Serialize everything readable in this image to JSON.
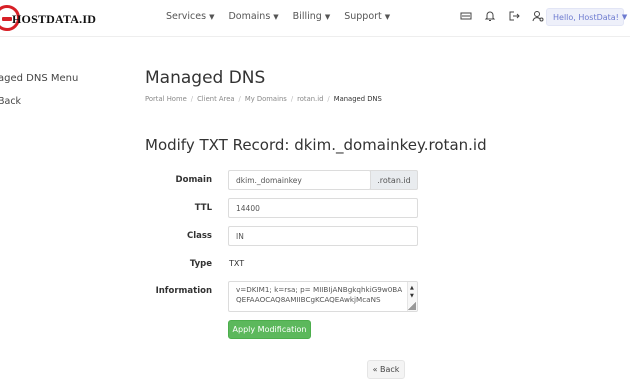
{
  "brand": {
    "name": "HOSTDATA.ID"
  },
  "nav": {
    "items": [
      {
        "label": "Services"
      },
      {
        "label": "Domains"
      },
      {
        "label": "Billing"
      },
      {
        "label": "Support"
      }
    ]
  },
  "header": {
    "icons": [
      "cart-icon",
      "bell-icon",
      "logout-icon",
      "user-settings-icon"
    ],
    "user_menu": "Hello, HostData!"
  },
  "sidebar": {
    "title": "aged DNS Menu",
    "back": "Back"
  },
  "page": {
    "title": "Managed DNS",
    "breadcrumb": [
      {
        "label": "Portal Home"
      },
      {
        "label": "Client Area"
      },
      {
        "label": "My Domains"
      },
      {
        "label": "rotan.id"
      },
      {
        "label": "Managed DNS"
      }
    ],
    "breadcrumb_sep": "/"
  },
  "form": {
    "title": "Modify TXT Record: dkim._domainkey.rotan.id",
    "domain_label": "Domain",
    "domain_value": "dkim._domainkey",
    "domain_suffix": ".rotan.id",
    "ttl_label": "TTL",
    "ttl_value": "14400",
    "class_label": "Class",
    "class_value": "IN",
    "type_label": "Type",
    "type_value": "TXT",
    "info_label": "Information",
    "info_value": "v=DKIM1; k=rsa; p= MIIBIjANBgkqhkiG9w0BAQEFAAOCAQ8AMIIBCgKCAQEAwkjMcaNS",
    "apply_label": "Apply Modification",
    "back_label": "« Back"
  }
}
